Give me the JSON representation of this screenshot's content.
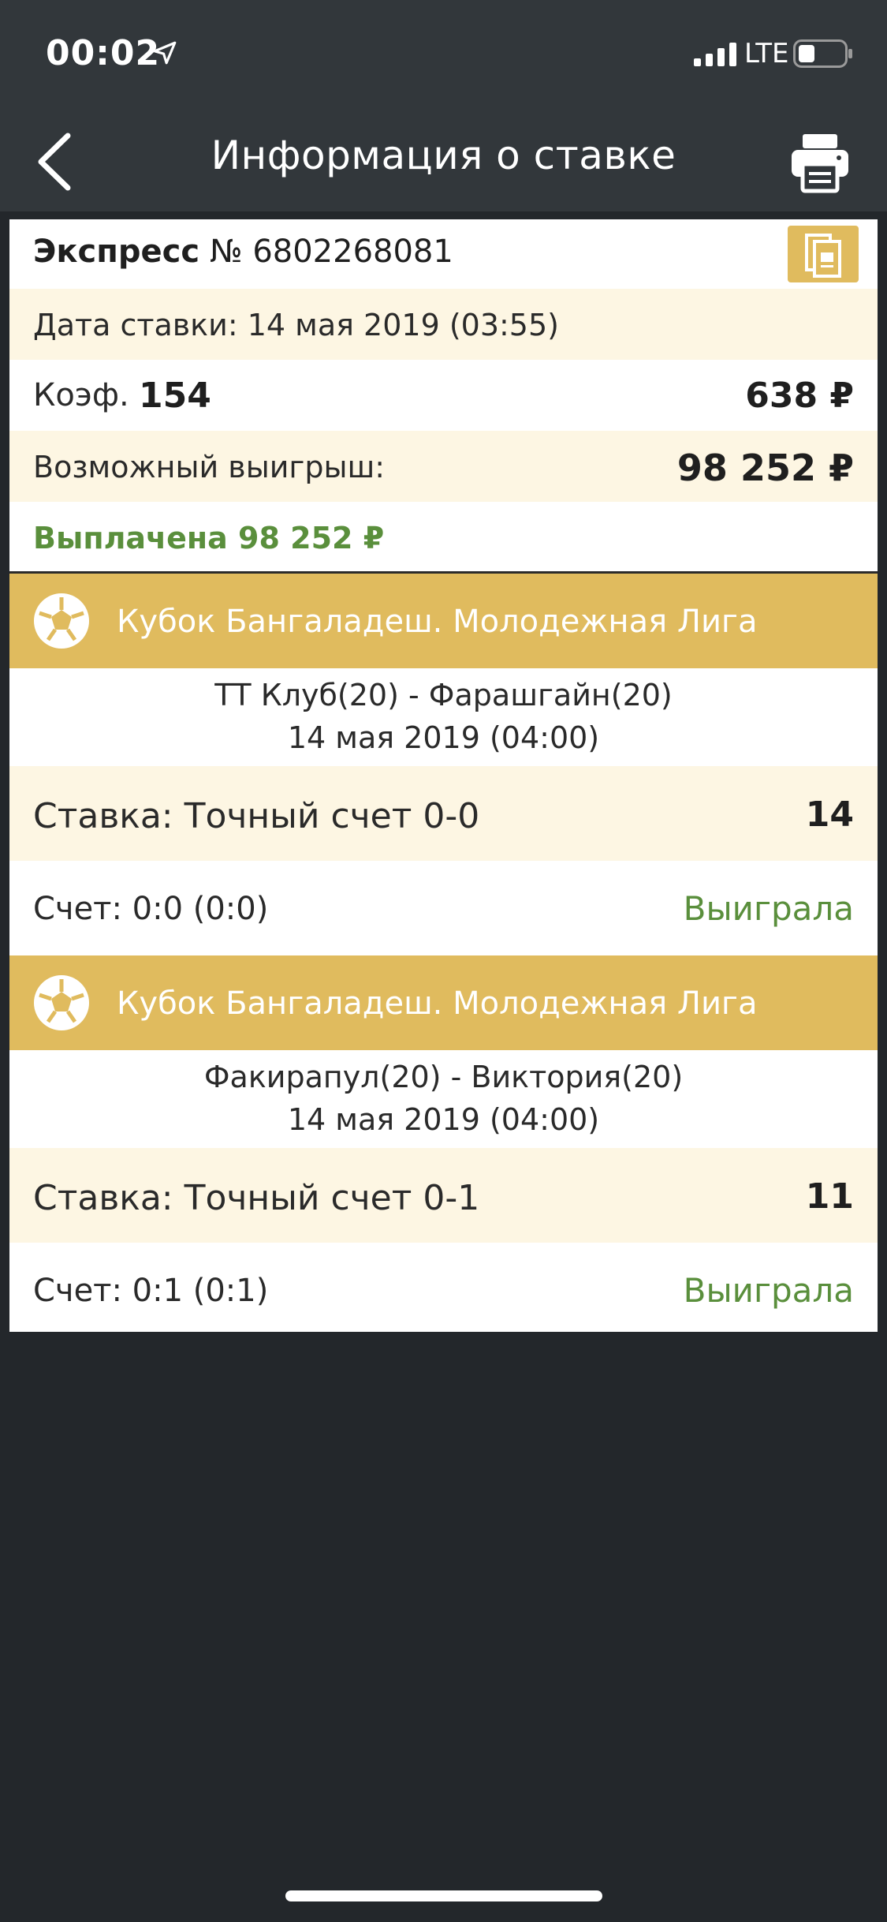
{
  "status_bar": {
    "time": "00:02",
    "network": "LTE",
    "icons": [
      "location-arrow-icon",
      "signal-icon",
      "battery-icon"
    ]
  },
  "nav": {
    "title": "Информация о ставке",
    "back_icon": "chevron-left-icon",
    "print_icon": "printer-icon"
  },
  "bet": {
    "type": "Экспресс",
    "number": "№ 6802268081",
    "copy_icon": "copy-icon",
    "date": "Дата ставки: 14 мая 2019 (03:55)",
    "coef_label": "Коэф.",
    "coef_value": "154",
    "stake": "638 ₽",
    "win_label": "Возможный выигрыш:",
    "win_value": "98 252 ₽",
    "paid": "Выплачена 98 252 ₽"
  },
  "events": [
    {
      "league": "Кубок Бангаладеш. Молодежная Лига",
      "teams": "ТТ Клуб(20) - Фарашгайн(20)",
      "date": "14 мая 2019 (04:00)",
      "stake": "Ставка: Точный счет 0-0",
      "coef": "14",
      "score": "Счет: 0:0 (0:0)",
      "result": "Выиграла"
    },
    {
      "league": "Кубок Бангаладеш. Молодежная Лига",
      "teams": "Факирапул(20) - Виктория(20)",
      "date": "14 мая 2019 (04:00)",
      "stake": "Ставка: Точный счет 0-1",
      "coef": "11",
      "score": "Счет: 0:1 (0:1)",
      "result": "Выиграла"
    }
  ],
  "colors": {
    "header_bg": "#32373b",
    "page_bg": "#23272b",
    "accent_gold": "#e0bb5e",
    "cream_row": "#fdf6e3",
    "win_green": "#5a8f3c"
  }
}
